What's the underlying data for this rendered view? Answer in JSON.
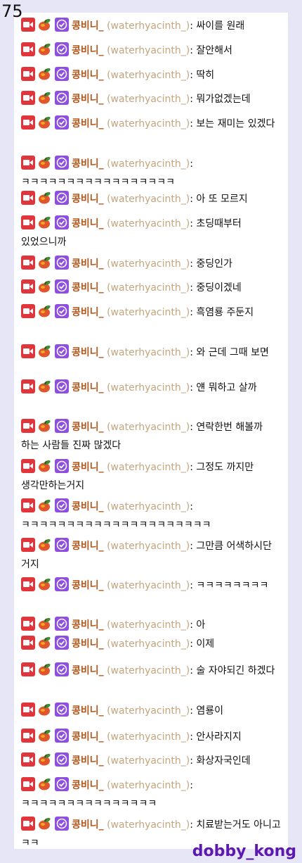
{
  "page_number": "75",
  "watermark": "dobby_kong",
  "user": {
    "nickname": "콩비니_",
    "user_id": "(waterhyacinth_)",
    "separator": ":"
  },
  "badges": [
    "broadcaster-badge-icon",
    "fruit-badge-icon",
    "verified-badge-icon"
  ],
  "colors": {
    "broadcaster": "#e0353b",
    "verified": "#8e4ee0",
    "nickname": "#b5561b",
    "user_id": "#c3a57e",
    "watermark": "#5d18b0"
  },
  "messages": [
    {
      "text": "싸이를 원래"
    },
    {
      "text": "잘안해서"
    },
    {
      "text": "딱히"
    },
    {
      "text": "뭐가없겠는데"
    },
    {
      "text": "보는 재미는 있겠다"
    },
    {
      "text": "ㅋㅋㅋㅋㅋㅋㅋㅋㅋㅋㅋㅋㅋㅋㅋㅋㅋ"
    },
    {
      "text": "아 또 모르지"
    },
    {
      "text": "초딩때부터 있었으니까"
    },
    {
      "text": "중딩인가"
    },
    {
      "text": "중딩이겠네"
    },
    {
      "text": "흑염룡 주둔지"
    },
    {
      "text": "와 근데 그때 보면"
    },
    {
      "text": "얜 뭐하고 살까"
    },
    {
      "text": "연락한번 해볼까 하는 사람들 진짜 많겠다"
    },
    {
      "text": "그정도 까지만 생각만하는거지"
    },
    {
      "text": "ㅋㅋㅋㅋㅋㅋㅋㅋㅋㅋㅋㅋㅋㅋㅋㅋㅋㅋㅋㅋㅋ"
    },
    {
      "text": "그만큼 어색하시단 거지"
    },
    {
      "text": "ㅋㅋㅋㅋㅋㅋㅋㅋ"
    },
    {
      "text": "아"
    },
    {
      "text": "이제"
    },
    {
      "text": "술 자야되긴 하겠다"
    },
    {
      "text": "염룡이"
    },
    {
      "text": "안사라지지"
    },
    {
      "text": "화상자국인데"
    },
    {
      "text": "ㅋㅋㅋㅋㅋㅋㅋㅋㅋㅋㅋㅋㅋㅋㅋ"
    },
    {
      "text": "치료받는거도 아니고 ㅋㅋ"
    }
  ]
}
